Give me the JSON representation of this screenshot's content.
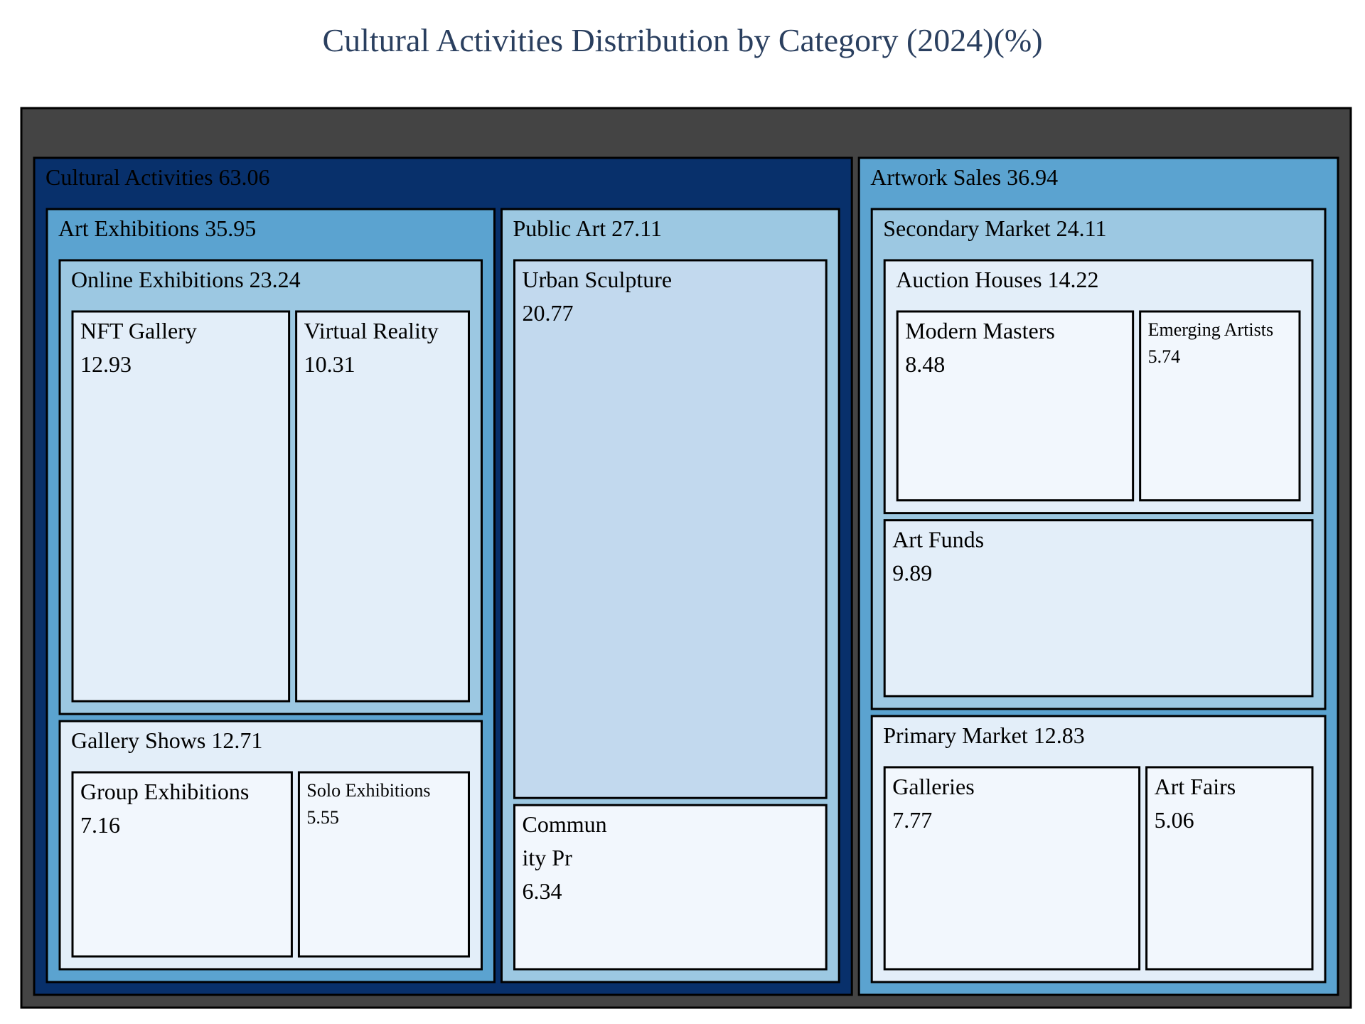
{
  "chart_data": {
    "type": "treemap",
    "title": "Cultural Activities Distribution by Category (2024)(%)",
    "unit": "%",
    "colors": {
      "root": "#444444",
      "level1_dark": "#08306b",
      "level1_mid": "#5ba3d0",
      "level2": "#9cc8e2",
      "level3": "#c2d9ee",
      "level4": "#e3eef9",
      "leaf_light": "#f2f7fd",
      "border": "#000000"
    },
    "root": {
      "name": "",
      "value": 100,
      "children": [
        {
          "name": "Cultural Activities",
          "value": 63.06,
          "children": [
            {
              "name": "Art Exhibitions",
              "value": 35.95,
              "children": [
                {
                  "name": "Online Exhibitions",
                  "value": 23.24,
                  "children": [
                    {
                      "name": "NFT Gallery",
                      "value": 12.93
                    },
                    {
                      "name": "Virtual Reality",
                      "value": 10.31
                    }
                  ]
                },
                {
                  "name": "Gallery Shows",
                  "value": 12.71,
                  "children": [
                    {
                      "name": "Group Exhibitions",
                      "value": 7.16
                    },
                    {
                      "name": "Solo Exhibitions",
                      "value": 5.55
                    }
                  ]
                }
              ]
            },
            {
              "name": "Public Art",
              "value": 27.11,
              "children": [
                {
                  "name": "Urban Sculpture",
                  "value": 20.77
                },
                {
                  "name": "Community Projects",
                  "display_lines": [
                    "Commun",
                    "ity Pr"
                  ],
                  "value": 6.34
                }
              ]
            }
          ]
        },
        {
          "name": "Artwork Sales",
          "value": 36.94,
          "children": [
            {
              "name": "Secondary Market",
              "value": 24.11,
              "children": [
                {
                  "name": "Auction Houses",
                  "value": 14.22,
                  "children": [
                    {
                      "name": "Modern Masters",
                      "value": 8.48
                    },
                    {
                      "name": "Emerging Artists",
                      "value": 5.74
                    }
                  ]
                },
                {
                  "name": "Art Funds",
                  "value": 9.89
                }
              ]
            },
            {
              "name": "Primary Market",
              "value": 12.83,
              "children": [
                {
                  "name": "Galleries",
                  "value": 7.77
                },
                {
                  "name": "Art Fairs",
                  "value": 5.06
                }
              ]
            }
          ]
        }
      ]
    }
  }
}
